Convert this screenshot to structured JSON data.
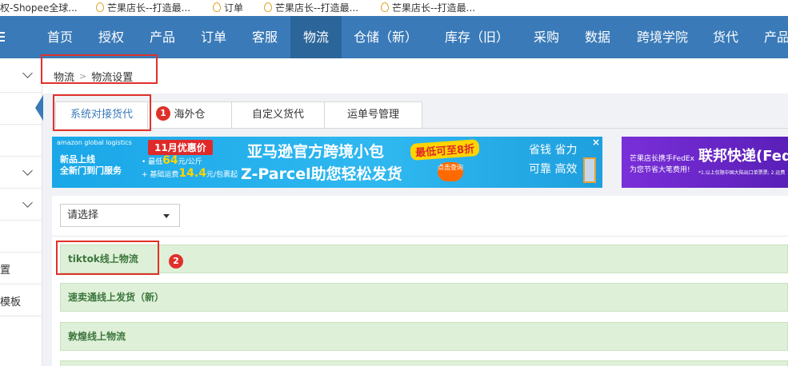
{
  "bookmarks": [
    {
      "label": "授权-Shopee全球..."
    },
    {
      "label": "芒果店长--打造最..."
    },
    {
      "label": "订单"
    },
    {
      "label": "芒果店长--打造最..."
    },
    {
      "label": "芒果店长--打造最..."
    }
  ],
  "nav": {
    "items": [
      "首页",
      "授权",
      "产品",
      "订单",
      "客服",
      "物流",
      "仓储（新）",
      "库存（旧）",
      "采购",
      "数据",
      "跨境学院",
      "货代",
      "产品"
    ],
    "active": "物流"
  },
  "sidebar": {
    "items": [
      "置",
      "模板"
    ]
  },
  "breadcrumb": {
    "parent": "物流",
    "separator": ">",
    "current": "物流设置"
  },
  "tabs": [
    {
      "label": "系统对接货代",
      "active": true
    },
    {
      "label": "海外仓",
      "active": false
    },
    {
      "label": "自定义货代",
      "active": false
    },
    {
      "label": "运单号管理",
      "active": false
    }
  ],
  "annotations": {
    "badge1": "1",
    "badge2": "2"
  },
  "banner_amazon": {
    "brand": "amazon global logistics",
    "line1": "新品上线",
    "line2": "全新门到门服务",
    "promo": "11月优惠价",
    "price1_prefix": "• 最低",
    "price1": "64",
    "price1_unit": "元/公斤",
    "price2_prefix": "+ 基础运费",
    "price2": "14.4",
    "price2_unit": "元/包裹起",
    "title1": "亚马逊官方跨境小包",
    "title2": "Z-Parcel助您轻松发货",
    "discount": "最低可至8折",
    "cta": "点击查询",
    "tag1": "省钱 省力",
    "tag2": "可靠 高效",
    "close": "×"
  },
  "banner_fedex": {
    "line1": "芒果店长携手FedEx",
    "line2": "为您节省大笔费用!",
    "title": "联邦快递(FedE",
    "note": "*1.以上仅限中国大陆出口单票票; 2.运费"
  },
  "filter": {
    "placeholder": "请选择"
  },
  "logistics": [
    {
      "label": "tiktok线上物流"
    },
    {
      "label": "速卖通线上发货（新）"
    },
    {
      "label": "敦煌线上物流"
    }
  ]
}
